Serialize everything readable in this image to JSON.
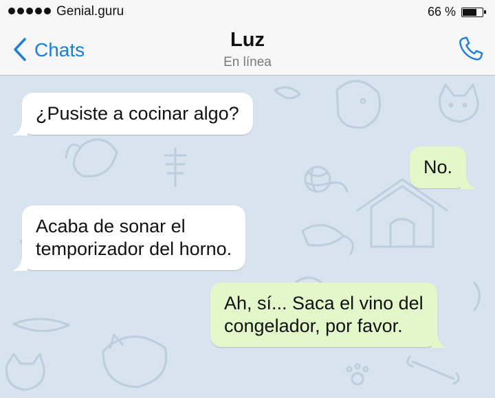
{
  "status_bar": {
    "carrier": "Genial.guru",
    "battery": "66 %",
    "battery_level": 0.66
  },
  "header": {
    "back_label": "Chats",
    "contact_name": "Luz",
    "contact_status": "En línea",
    "icons": [
      "back-chevron",
      "phone"
    ]
  },
  "messages": [
    {
      "direction": "incoming",
      "text": "¿Pusiste a cocinar algo?"
    },
    {
      "direction": "outgoing",
      "text": "No."
    },
    {
      "direction": "incoming",
      "lines": [
        "Acaba de sonar el",
        "temporizador del horno."
      ]
    },
    {
      "direction": "outgoing",
      "lines": [
        "Ah, sí... Saca el vino del",
        "congelador, por favor."
      ]
    }
  ],
  "colors": {
    "accent": "#1a7de0",
    "background": "#d7e3ee",
    "incoming_bubble": "#ffffff",
    "outgoing_bubble": "#e2f8c9"
  }
}
